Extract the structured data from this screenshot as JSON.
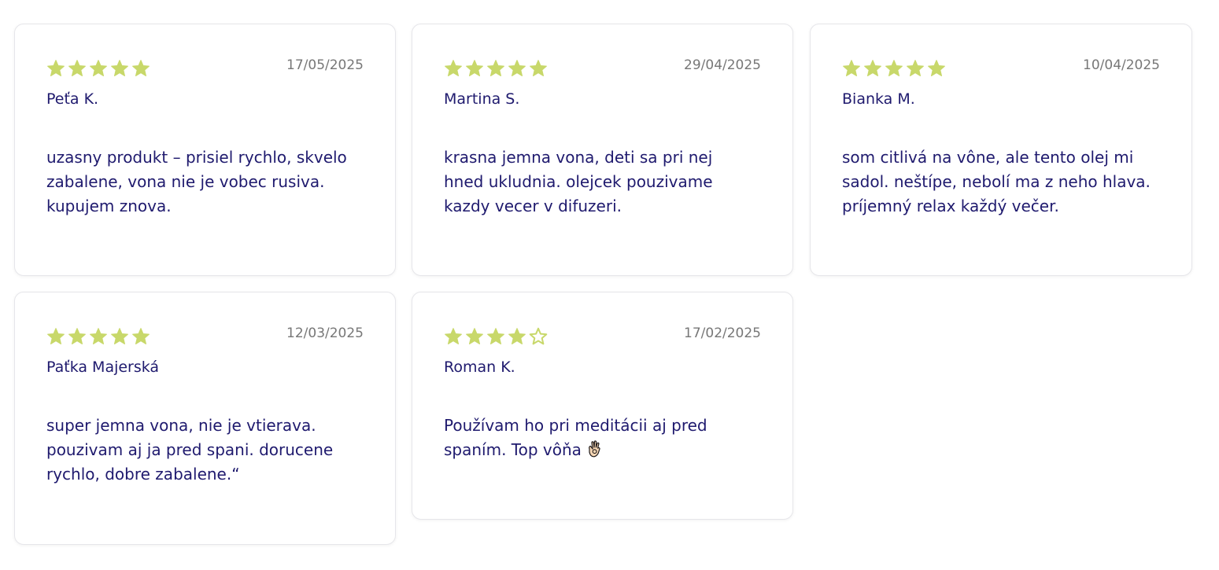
{
  "colors": {
    "star_fill": "#c8d86a",
    "text": "#1f1a6e",
    "date": "#777777",
    "card_border": "#e6e6ea"
  },
  "reviews": [
    {
      "rating": 5,
      "date": "17/05/2025",
      "author": "Peťa K.",
      "text": "uzasny produkt – prisiel rychlo, skvelo zabalene, vona nie je vobec rusiva. kupujem znova."
    },
    {
      "rating": 5,
      "date": "29/04/2025",
      "author": "Martina S.",
      "text": "krasna jemna vona, deti sa pri nej hned ukludnia. olejcek pouzivame kazdy vecer v difuzeri."
    },
    {
      "rating": 5,
      "date": "10/04/2025",
      "author": "Bianka M.",
      "text": "som citlivá na vône, ale tento olej mi sadol. neštípe, nebolí ma z neho hlava. príjemný relax každý večer."
    },
    {
      "rating": 5,
      "date": "12/03/2025",
      "author": "Paťka Majerská",
      "text": "super jemna vona, nie je vtierava. pouzivam aj ja pred spani. dorucene rychlo, dobre zabalene.“"
    },
    {
      "rating": 4,
      "date": "17/02/2025",
      "author": "Roman K.",
      "text": "Používam ho pri meditácii aj pred spaním. Top vôňa",
      "emoji_icon": "ok-hand-icon"
    }
  ]
}
